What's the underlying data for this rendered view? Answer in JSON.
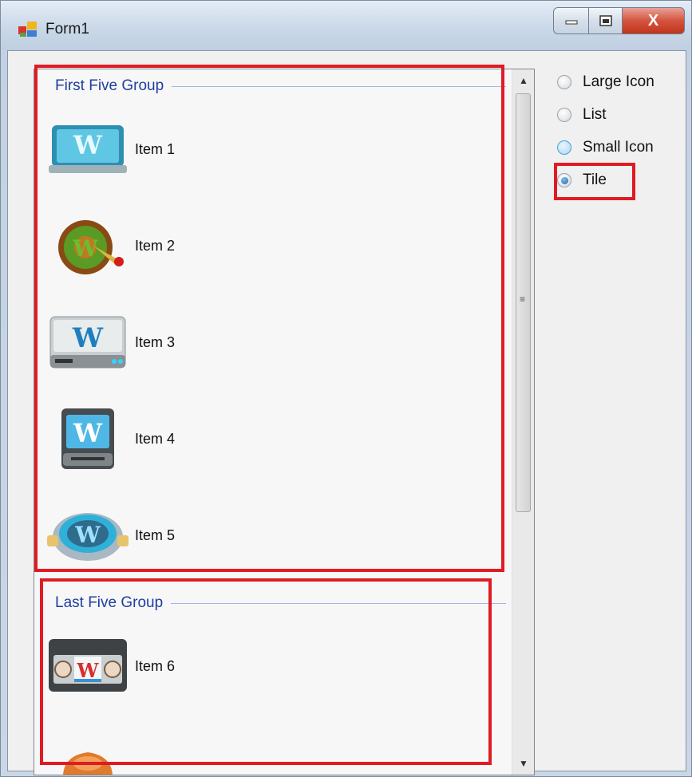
{
  "window": {
    "title": "Form1",
    "close_glyph": "X",
    "icon_names": {
      "app": "form-app-icon",
      "minimize": "minimize-icon",
      "maximize": "maximize-icon",
      "close": "close-icon"
    }
  },
  "listview": {
    "groups": [
      {
        "header": "First Five Group",
        "items": [
          {
            "label": "Item 1",
            "icon": "wordpress-monitor-icon"
          },
          {
            "label": "Item 2",
            "icon": "wordpress-dart-icon"
          },
          {
            "label": "Item 3",
            "icon": "wordpress-drive-icon"
          },
          {
            "label": "Item 4",
            "icon": "wordpress-hdd-icon"
          },
          {
            "label": "Item 5",
            "icon": "wordpress-pot-icon"
          }
        ]
      },
      {
        "header": "Last Five Group",
        "items": [
          {
            "label": "Item 6",
            "icon": "wordpress-vhs-icon"
          },
          {
            "label": "",
            "icon": "wordpress-phone-icon"
          }
        ]
      }
    ],
    "scrollbar": {
      "up_glyph": "▲",
      "down_glyph": "▼",
      "grip_glyph": "≡"
    }
  },
  "view_options": [
    {
      "label": "Large Icon",
      "checked": false
    },
    {
      "label": "List",
      "checked": false
    },
    {
      "label": "Small Icon",
      "checked": false,
      "hover": true
    },
    {
      "label": "Tile",
      "checked": true
    }
  ],
  "colors": {
    "highlight": "#e01b24",
    "group_header": "#1e3f9e"
  }
}
